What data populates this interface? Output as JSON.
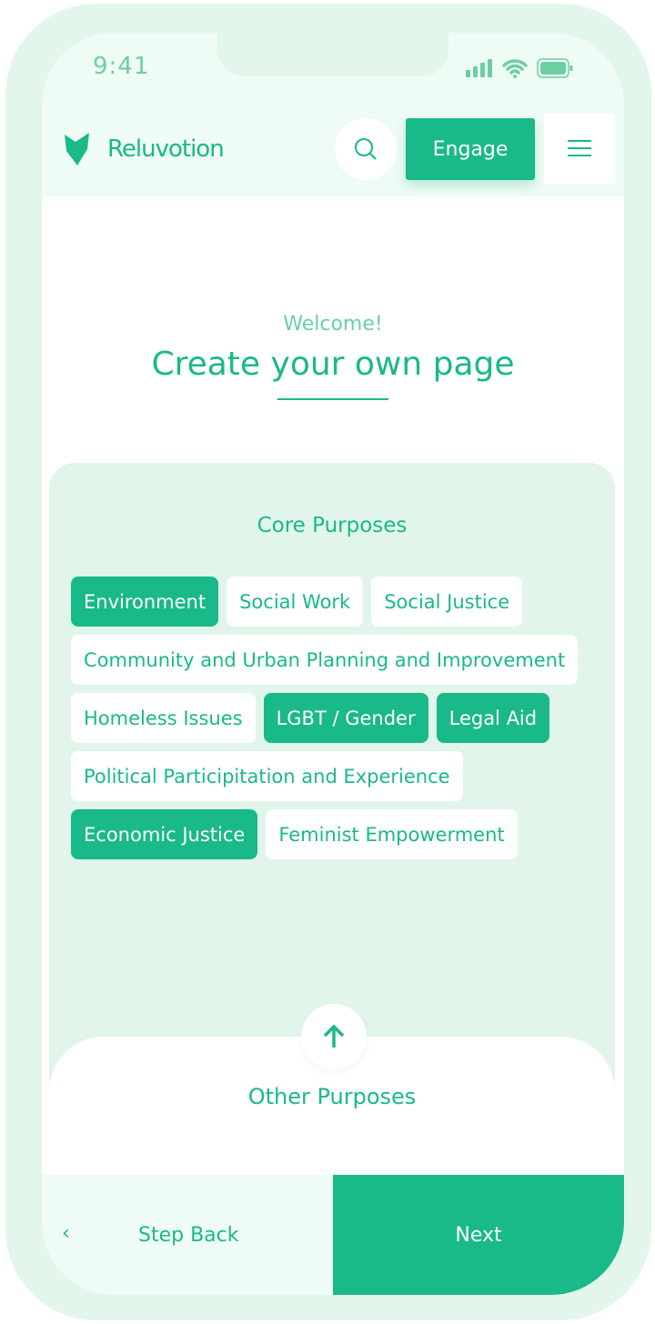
{
  "status_bar": {
    "time": "9:41"
  },
  "header": {
    "brand": "Reluvotion",
    "engage_label": "Engage"
  },
  "hero": {
    "welcome": "Welcome!",
    "title": "Create your own page"
  },
  "core": {
    "title": "Core Purposes",
    "tags": [
      {
        "label": "Environment",
        "selected": true
      },
      {
        "label": "Social Work",
        "selected": false
      },
      {
        "label": "Social Justice",
        "selected": false
      },
      {
        "label": "Community and Urban Planning and Improvement",
        "selected": false
      },
      {
        "label": "Homeless Issues",
        "selected": false
      },
      {
        "label": "LGBT / Gender",
        "selected": true
      },
      {
        "label": "Legal Aid",
        "selected": true
      },
      {
        "label": "Political Participitation and Experience",
        "selected": false
      },
      {
        "label": "Economic Justice",
        "selected": true
      },
      {
        "label": "Feminist Empowerment",
        "selected": false
      }
    ]
  },
  "other": {
    "title": "Other Purposes"
  },
  "footer": {
    "back_label": "Step Back",
    "next_label": "Next"
  },
  "colors": {
    "accent": "#19b989",
    "light": "#e1f5eb"
  }
}
